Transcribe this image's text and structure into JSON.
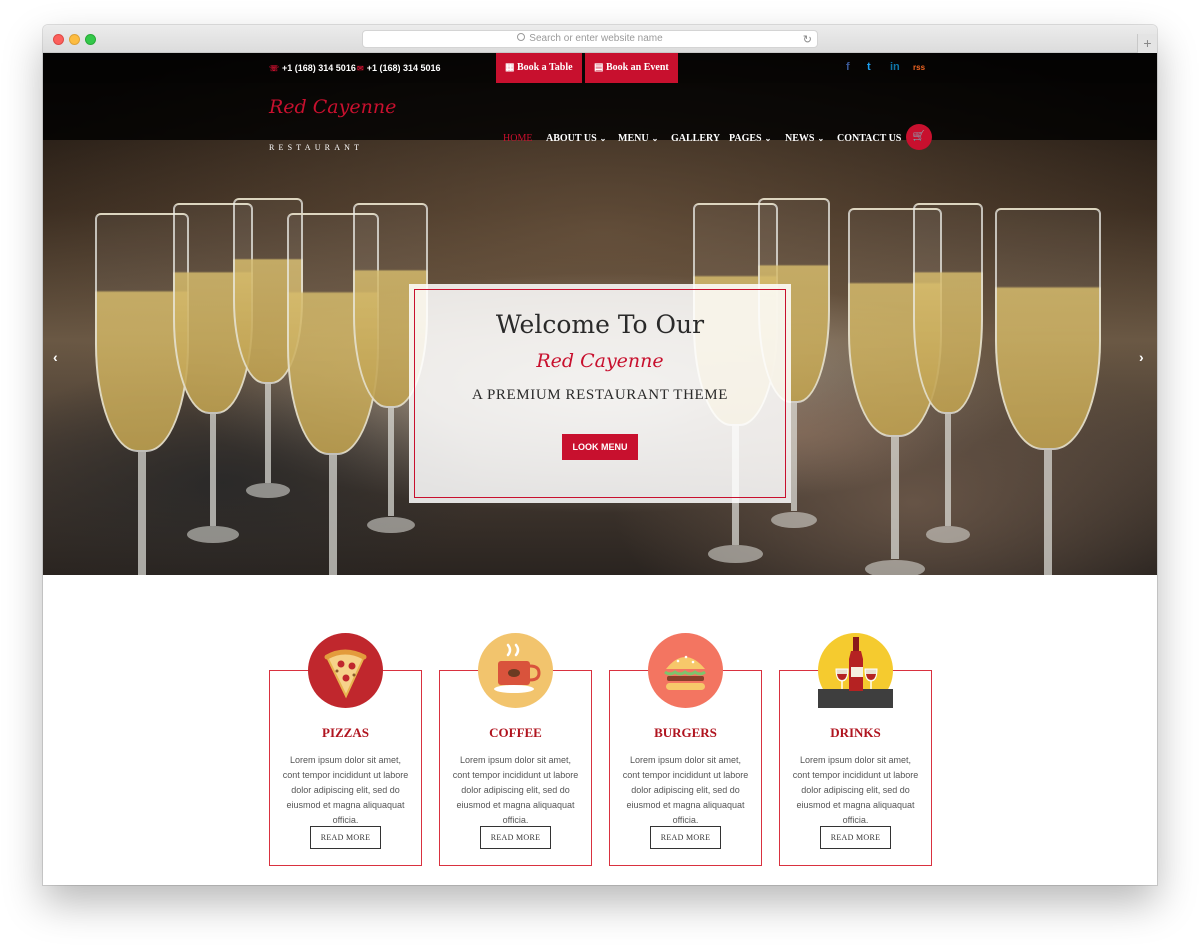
{
  "browser": {
    "url_placeholder": "Search or enter website name",
    "new_tab_label": "+"
  },
  "topbar": {
    "phone_1": "+1 (168) 314 5016",
    "phone_2": "+1 (168) 314 5016",
    "book_table": "Book a Table",
    "book_event": "Book an Event",
    "social": [
      "f",
      "t",
      "in",
      "rss"
    ]
  },
  "brand": {
    "name": "Red Cayenne",
    "sub": "RESTAURANT"
  },
  "nav": {
    "items": [
      "HOME",
      "ABOUT US",
      "MENU",
      "GALLERY",
      "PAGES",
      "NEWS",
      "CONTACT US"
    ],
    "chevron": "⌄"
  },
  "hero": {
    "title": "Welcome To Our",
    "script": "Red Cayenne",
    "subtitle": "A PREMIUM RESTAURANT THEME",
    "button": "LOOK MENU",
    "prev_arrow": "‹",
    "next_arrow": "›"
  },
  "features": [
    {
      "title": "PIZZAS",
      "text": "Lorem ipsum dolor sit amet, cont tempor incididunt ut labore dolor adipiscing elit, sed do eiusmod et magna aliquaquat officia.",
      "button": "READ MORE",
      "icon": "pizza-icon",
      "color": "#c0272d"
    },
    {
      "title": "COFFEE",
      "text": "Lorem ipsum dolor sit amet, cont tempor incididunt ut labore dolor adipiscing elit, sed do eiusmod et magna aliquaquat officia.",
      "button": "READ MORE",
      "icon": "coffee-icon",
      "color": "#f2c46d"
    },
    {
      "title": "BURGERS",
      "text": "Lorem ipsum dolor sit amet, cont tempor incididunt ut labore dolor adipiscing elit, sed do eiusmod et magna aliquaquat officia.",
      "button": "READ MORE",
      "icon": "burger-icon",
      "color": "#f37561"
    },
    {
      "title": "DRINKS",
      "text": "Lorem ipsum dolor sit amet, cont tempor incididunt ut labore dolor adipiscing elit, sed do eiusmod et magna aliquaquat officia.",
      "button": "READ MORE",
      "icon": "wine-icon",
      "color": "#f5cb2f"
    }
  ],
  "colors": {
    "accent": "#c8102e",
    "card_border": "#d9313f"
  }
}
